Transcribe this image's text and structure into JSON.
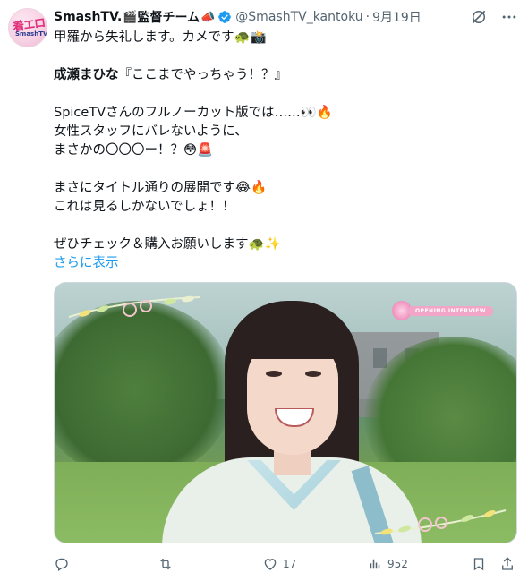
{
  "author": {
    "avatar_text_top": "着エロ",
    "avatar_text_bottom": "SmashTV",
    "name": "SmashTV.",
    "name_emoji": "🎬",
    "name_suffix": "監督チーム",
    "name_suffix_emoji": "📣",
    "handle": "@SmashTV_kantoku",
    "separator": "·",
    "date": "9月19日"
  },
  "tweet": {
    "lines": [
      "甲羅から失礼します。カメです🐢📸",
      "",
      "",
      "SpiceTVさんのフルノーカット版では……👀🔥",
      " 女性スタッフにバレないように、",
      "まさかの〇〇〇ー！？😳🚨",
      "",
      "まさにタイトル通りの展開です😂🔥",
      "これは見るしかないでしょ！！",
      "",
      "ぜひチェック＆購入お願いします🐢✨"
    ],
    "title_bold": "成瀬まひな",
    "title_rest": "『ここまでやっちゃう！？』",
    "show_more": "さらに表示"
  },
  "media": {
    "tag": "OPENING INTERVIEW"
  },
  "actions": {
    "replies": "",
    "retweets": "",
    "likes": "17",
    "views": "952"
  },
  "colors": {
    "accent": "#1d9bf0",
    "muted": "#536471",
    "text": "#0f1419"
  },
  "icons": [
    "grok-icon",
    "more-icon",
    "reply-icon",
    "retweet-icon",
    "like-icon",
    "views-icon",
    "bookmark-icon",
    "share-icon",
    "verified-icon"
  ]
}
